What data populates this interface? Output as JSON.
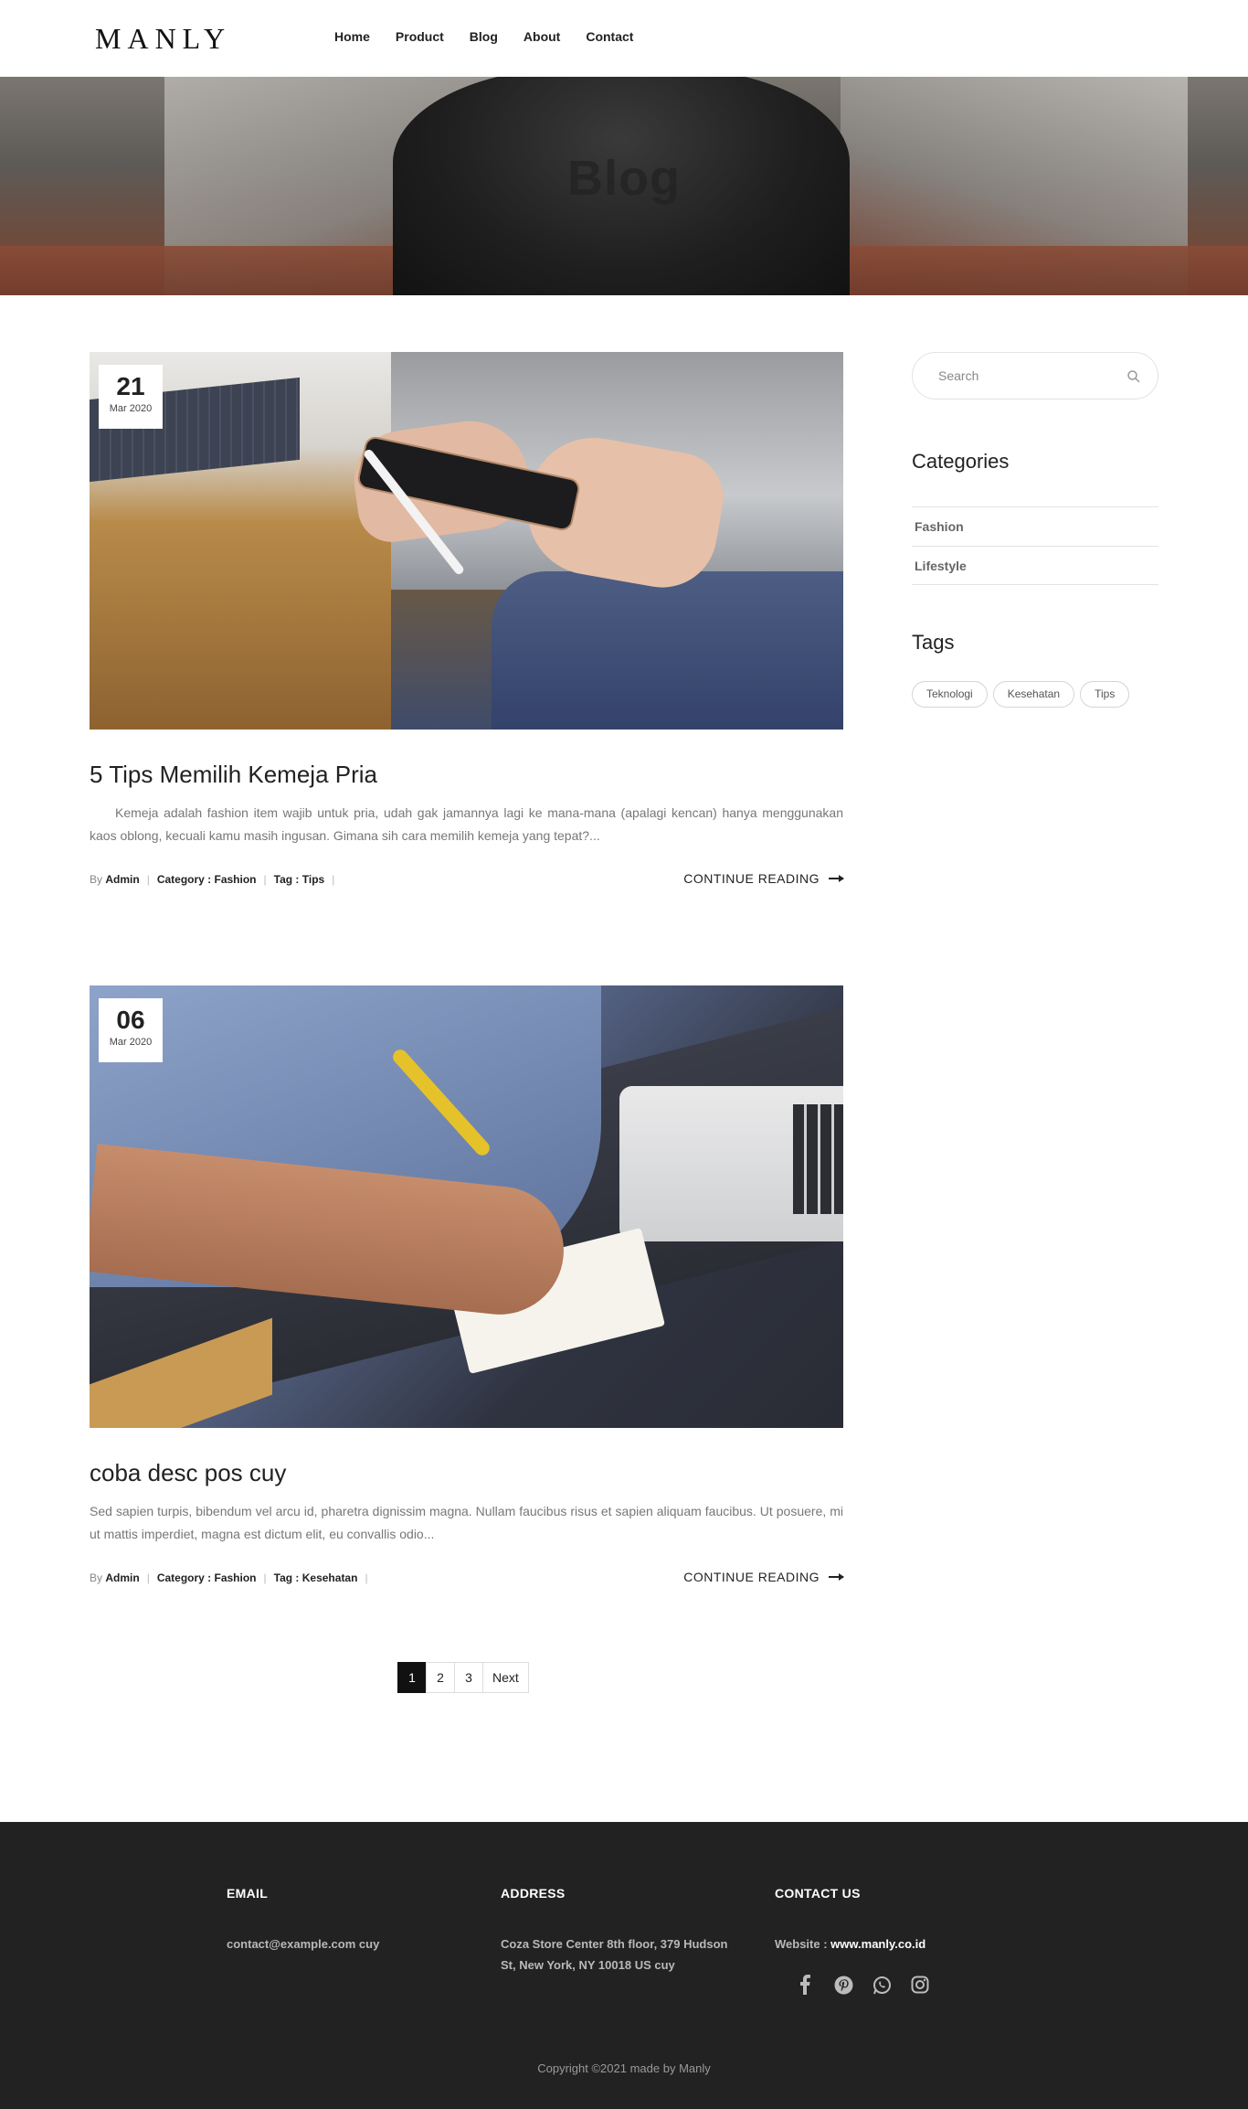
{
  "header": {
    "logo": "MANLY",
    "nav": [
      "Home",
      "Product",
      "Blog",
      "About",
      "Contact"
    ]
  },
  "hero": {
    "title": "Blog"
  },
  "posts": [
    {
      "day": "21",
      "month": "Mar 2020",
      "title": "5 Tips Memilih Kemeja Pria",
      "excerpt": "Kemeja adalah fashion item wajib untuk pria, udah gak jamannya lagi ke mana-mana (apalagi kencan) hanya menggunakan kaos oblong, kecuali kamu masih ingusan. Gimana sih cara memilih kemeja yang tepat?...",
      "by": "By",
      "author": "Admin",
      "category": "Category : Fashion",
      "tag": "Tag : Tips",
      "continue": "CONTINUE READING"
    },
    {
      "day": "06",
      "month": "Mar 2020",
      "title": "coba desc pos cuy",
      "excerpt": "Sed sapien turpis, bibendum vel arcu id, pharetra dignissim magna. Nullam faucibus risus et sapien aliquam faucibus. Ut posuere, mi ut mattis imperdiet, magna est dictum elit, eu convallis odio...",
      "by": "By",
      "author": "Admin",
      "category": "Category : Fashion",
      "tag": "Tag : Kesehatan",
      "continue": "CONTINUE READING"
    }
  ],
  "sidebar": {
    "search_placeholder": "Search",
    "categories_title": "Categories",
    "categories": [
      "Fashion",
      "Lifestyle"
    ],
    "tags_title": "Tags",
    "tags": [
      "Teknologi",
      "Kesehatan",
      "Tips"
    ]
  },
  "pagination": {
    "pages": [
      "1",
      "2",
      "3"
    ],
    "next": "Next",
    "active": "1"
  },
  "footer": {
    "email_head": "EMAIL",
    "email": "contact@example.com cuy",
    "address_head": "ADDRESS",
    "address_line1": "Coza Store Center 8th floor, 379 Hudson",
    "address_line2": "St, New York, NY 10018 US cuy",
    "contact_head": "CONTACT US",
    "website_label": "Website : ",
    "website": "www.manly.co.id",
    "socials": [
      "facebook-icon",
      "pinterest-icon",
      "whatsapp-icon",
      "instagram-icon"
    ],
    "copyright": "Copyright ©2021 made by Manly"
  }
}
